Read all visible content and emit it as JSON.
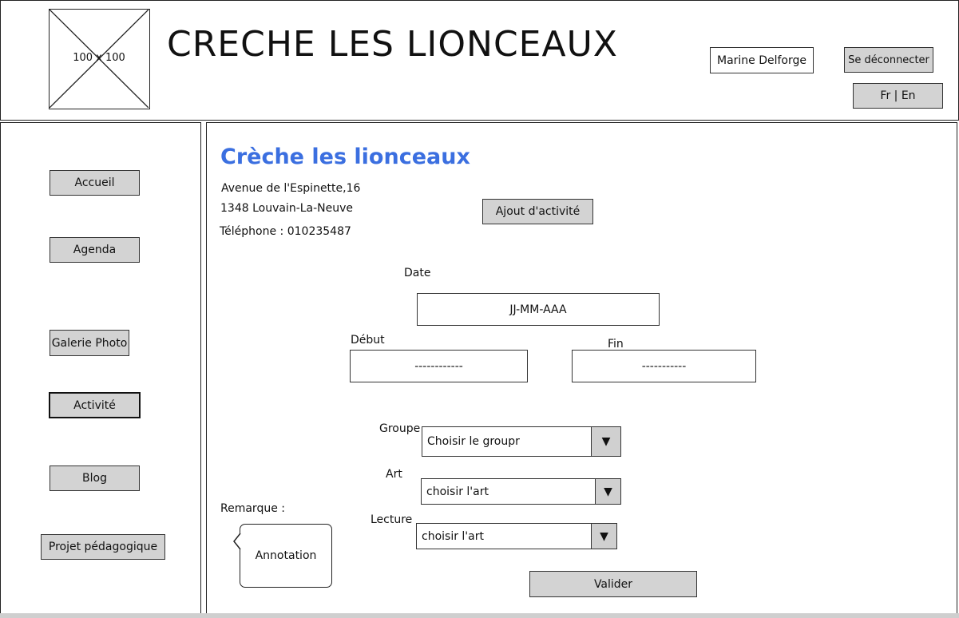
{
  "header": {
    "logo_placeholder": "100 x 100",
    "title": "CRECHE LES LIONCEAUX",
    "user_name": "Marine Delforge",
    "logout_label": "Se déconnecter",
    "lang_label": "Fr | En"
  },
  "sidebar": {
    "items": [
      {
        "label": "Accueil"
      },
      {
        "label": "Agenda"
      },
      {
        "label": "Galerie Photo"
      },
      {
        "label": "Activité",
        "active": true
      },
      {
        "label": "Blog"
      },
      {
        "label": "Projet pédagogique"
      }
    ]
  },
  "main": {
    "heading": "Crèche les lionceaux",
    "address_line1": "Avenue de l'Espinette,16",
    "address_line2": "1348 Louvain-La-Neuve",
    "phone": "Téléphone : 010235487",
    "add_activity_label": "Ajout d'activité",
    "date_label": "Date",
    "date_value": "JJ-MM-AAA",
    "start_label": "Début",
    "start_value": "------------",
    "end_label": "Fin",
    "end_value": "-----------",
    "group_label": "Groupe",
    "group_value": "Choisir le groupr",
    "art_label": "Art",
    "art_value": "choisir l'art",
    "reading_label": "Lecture",
    "reading_value": "choisir l'art",
    "remark_label": "Remarque :",
    "annotation_text": "Annotation",
    "submit_label": "Valider",
    "arrow_glyph": "▼"
  },
  "colors": {
    "heading": "#3b6fe0",
    "button_bg": "#d3d3d3",
    "border": "#222222"
  }
}
